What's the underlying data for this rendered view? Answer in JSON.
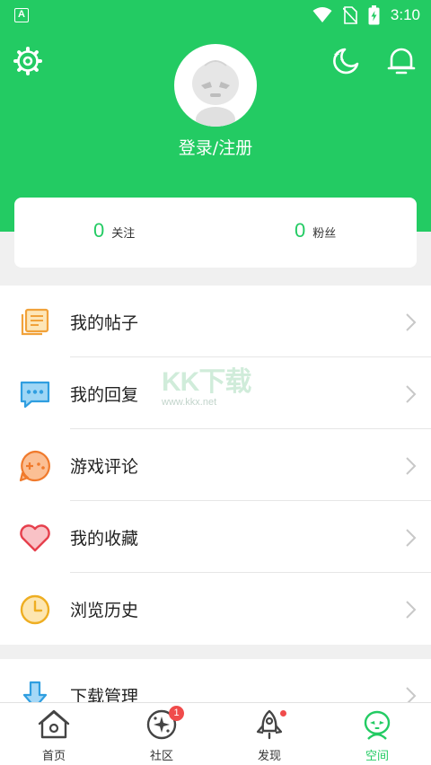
{
  "status_bar": {
    "notification_icon": "A",
    "time": "3:10",
    "icons": [
      "wifi-icon",
      "no-sim-icon",
      "battery-charging-icon"
    ]
  },
  "header": {
    "login_text": "登录/注册",
    "icons": [
      "settings-icon",
      "night-mode-icon",
      "bell-icon"
    ]
  },
  "stats": {
    "follow": {
      "count": "0",
      "label": "关注"
    },
    "fans": {
      "count": "0",
      "label": "粉丝"
    }
  },
  "menu": {
    "items": [
      {
        "label": "我的帖子",
        "icon": "posts-icon"
      },
      {
        "label": "我的回复",
        "icon": "reply-icon"
      },
      {
        "label": "游戏评论",
        "icon": "game-review-icon"
      },
      {
        "label": "我的收藏",
        "icon": "heart-icon"
      },
      {
        "label": "浏览历史",
        "icon": "clock-icon"
      }
    ],
    "items2": [
      {
        "label": "下载管理",
        "icon": "download-icon"
      }
    ]
  },
  "watermark": {
    "main": "KK下载",
    "sub": "www.kkx.net"
  },
  "tabbar": {
    "tabs": [
      {
        "label": "首页",
        "icon": "home-icon"
      },
      {
        "label": "社区",
        "icon": "community-icon",
        "badge": "1"
      },
      {
        "label": "发现",
        "icon": "rocket-icon"
      },
      {
        "label": "空间",
        "icon": "space-icon"
      }
    ]
  },
  "colors": {
    "brand": "#23cb63",
    "badge": "#f04b4b",
    "background": "#f0f0f0"
  }
}
